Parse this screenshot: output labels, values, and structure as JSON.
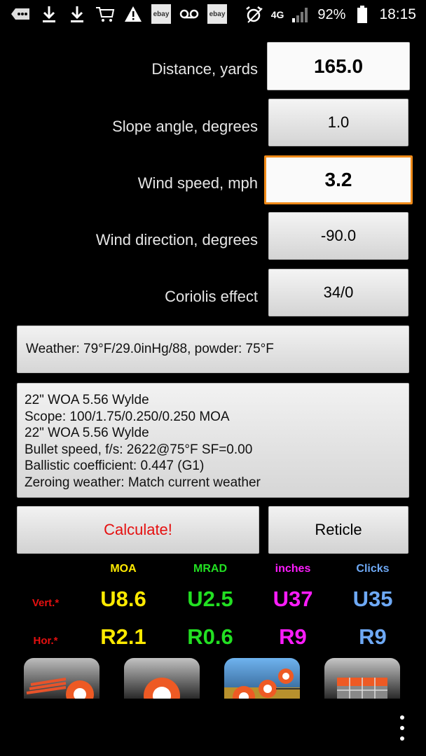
{
  "status_bar": {
    "icons_left": [
      "more-icon",
      "download-icon",
      "download-icon",
      "cart-icon",
      "warning-icon",
      "ebay-icon",
      "voicemail-icon",
      "ebay-icon"
    ],
    "ebay_label": "ebay",
    "network": "4G",
    "battery": "92%",
    "time": "18:15"
  },
  "inputs": {
    "distance": {
      "label": "Distance, yards",
      "value": "165.0"
    },
    "slope": {
      "label": "Slope angle, degrees",
      "value": "1.0"
    },
    "wind_speed": {
      "label": "Wind speed, mph",
      "value": "3.2"
    },
    "wind_direction": {
      "label": "Wind direction, degrees",
      "value": "-90.0"
    },
    "coriolis": {
      "label": "Coriolis effect",
      "value": "34/0"
    }
  },
  "weather": {
    "text": "Weather: 79°F/29.0inHg/88, powder: 75°F"
  },
  "rifle": {
    "lines": [
      "22\" WOA 5.56 Wylde",
      "Scope: 100/1.75/0.250/0.250 MOA",
      "22\" WOA 5.56 Wylde",
      "Bullet speed, f/s: 2622@75°F SF=0.00",
      "Ballistic coefficient: 0.447 (G1)",
      "Zeroing weather: Match current weather"
    ]
  },
  "buttons": {
    "calculate": "Calculate!",
    "reticle": "Reticle"
  },
  "results": {
    "columns": [
      "MOA",
      "MRAD",
      "inches",
      "Clicks"
    ],
    "rows": [
      "Vert.*",
      "Hor.*"
    ],
    "vertical": [
      "U8.6",
      "U2.5",
      "U37",
      "U35"
    ],
    "horizontal": [
      "R2.1",
      "R0.6",
      "R9",
      "R9"
    ]
  },
  "colors": {
    "accent_orange": "#f08a18",
    "calculate_red": "#e51010",
    "moa_yellow": "#ffea00",
    "mrad_green": "#1ed760",
    "inches_magenta": "#ff1cff",
    "clicks_blue": "#6ea9f5"
  },
  "bottom_icons": [
    "speed-app-icon",
    "target-app-icon",
    "range-app-icon",
    "chart-app-icon"
  ]
}
